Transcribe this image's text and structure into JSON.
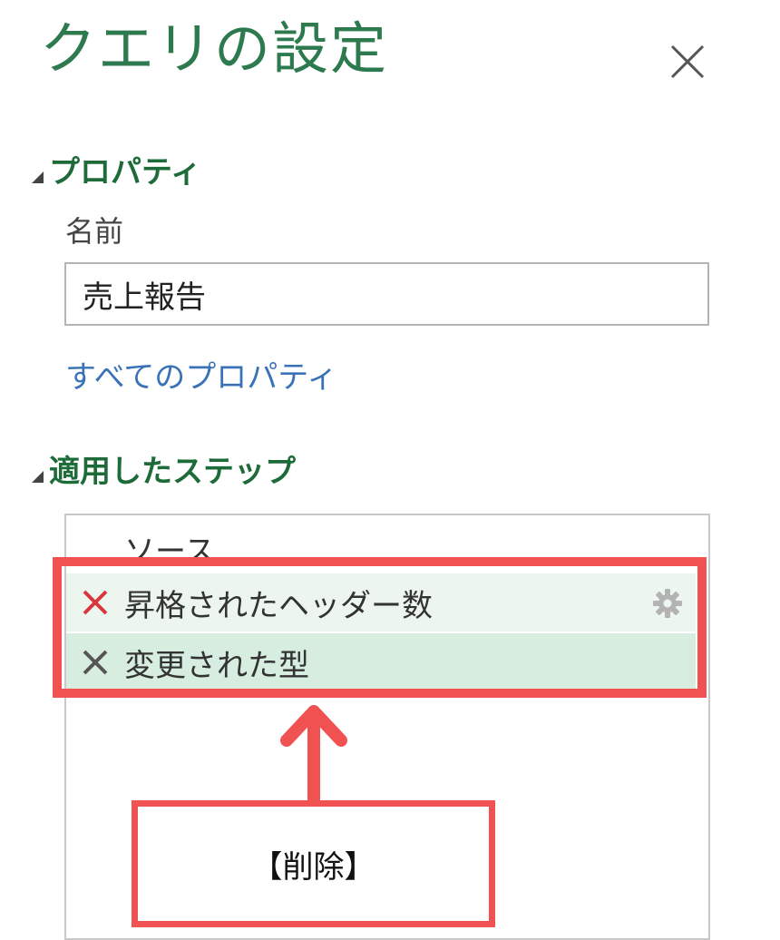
{
  "panel": {
    "title": "クエリの設定"
  },
  "properties": {
    "section_title": "プロパティ",
    "name_label": "名前",
    "name_value": "売上報告",
    "all_properties_link": "すべてのプロパティ"
  },
  "applied_steps": {
    "section_title": "適用したステップ",
    "items": [
      {
        "label": "ソース"
      },
      {
        "label": "昇格されたヘッダー数",
        "delete_icon": "delete-x-icon",
        "delete_color": "#d9363e",
        "settings_icon": "gear-icon"
      },
      {
        "label": "変更された型",
        "delete_icon": "delete-x-icon",
        "delete_color": "#555555"
      }
    ]
  },
  "annotation": {
    "callout_text": "【削除】",
    "highlight_color": "#f05252"
  },
  "colors": {
    "title": "#2d7a4f",
    "section_title": "#1e6b3a",
    "link": "#3a72b8",
    "step_selected_bg": "#d6ede0",
    "step_hover_bg": "#ecf5ee"
  }
}
